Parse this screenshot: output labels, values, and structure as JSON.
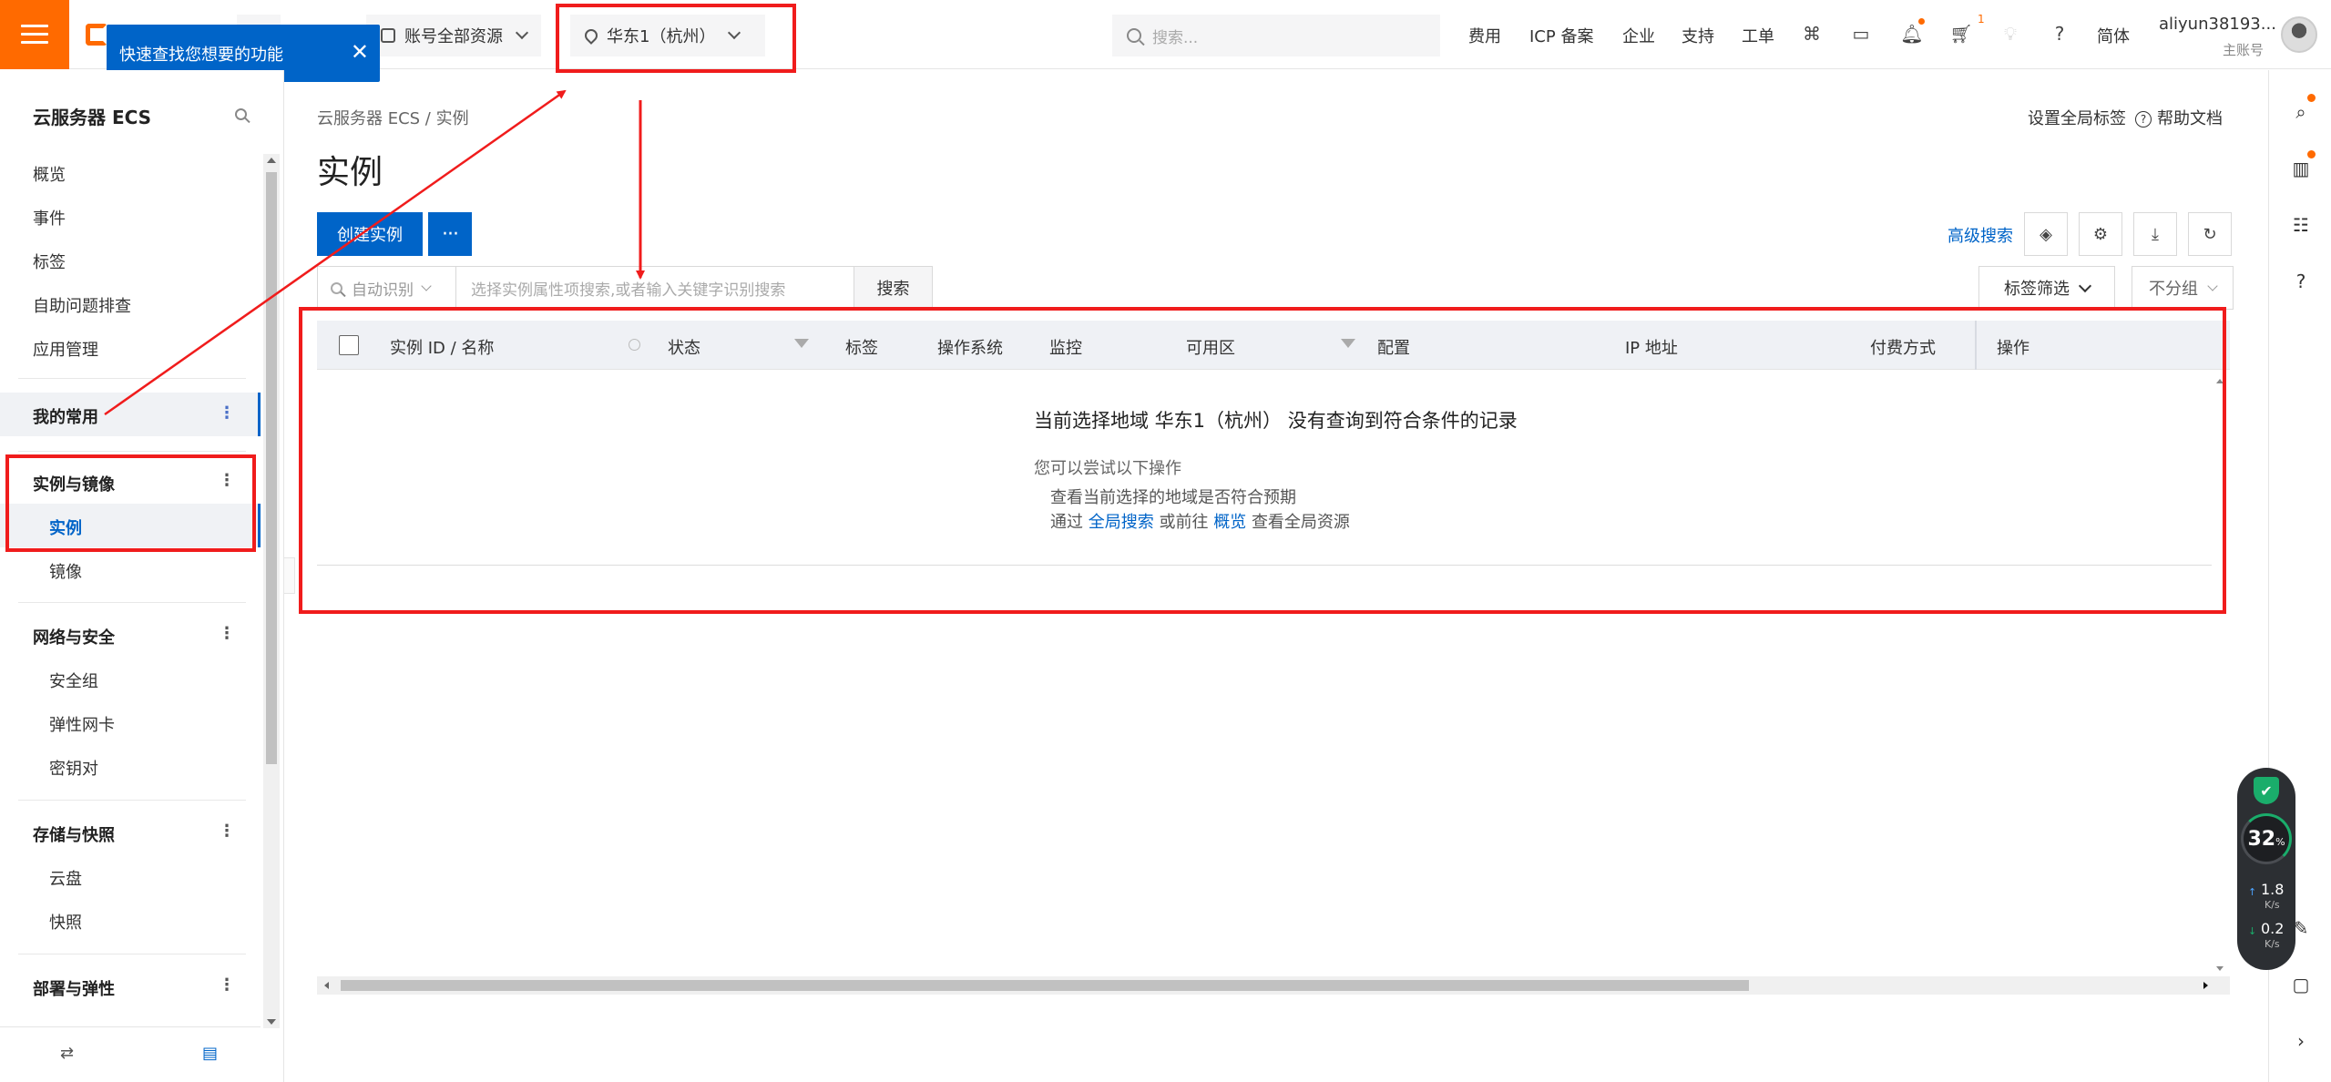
{
  "topbar": {
    "account_scope": "账号全部资源",
    "region": "华东1（杭州）",
    "search_placeholder": "搜索...",
    "links": [
      "费用",
      "ICP 备案",
      "企业",
      "支持",
      "工单"
    ],
    "cart_badge": "1",
    "language": "简体",
    "username": "aliyun38193...",
    "account_type": "主账号"
  },
  "tooltip": {
    "text": "快速查找您想要的功能",
    "close": "✕"
  },
  "sidebar": {
    "title": "云服务器 ECS",
    "items": [
      "概览",
      "事件",
      "标签",
      "自助问题排查",
      "应用管理"
    ],
    "favorites": "我的常用",
    "groups": [
      {
        "label": "实例与镜像",
        "items": [
          "实例",
          "镜像"
        ]
      },
      {
        "label": "网络与安全",
        "items": [
          "安全组",
          "弹性网卡",
          "密钥对"
        ]
      },
      {
        "label": "存储与快照",
        "items": [
          "云盘",
          "快照"
        ]
      },
      {
        "label": "部署与弹性",
        "items": []
      }
    ],
    "more_icon": "⋮"
  },
  "main": {
    "breadcrumb": "云服务器 ECS  /  实例",
    "page_title": "实例",
    "set_tags": "设置全局标签",
    "help_docs": "帮助文档",
    "create_button": "创建实例",
    "more_button": "···",
    "advanced_search": "高级搜索",
    "filter": {
      "mode": "自动识别",
      "placeholder": "选择实例属性项搜索,或者输入关键字识别搜索",
      "search_button": "搜索",
      "tag_filter": "标签筛选",
      "group": "不分组"
    },
    "columns": [
      "实例 ID / 名称",
      "状态",
      "标签",
      "操作系统",
      "监控",
      "可用区",
      "配置",
      "IP 地址",
      "付费方式",
      "操作"
    ],
    "empty": {
      "title": "当前选择地域 华东1（杭州） 没有查询到符合条件的记录",
      "hint": "您可以尝试以下操作",
      "line1": "查看当前选择的地域是否符合预期",
      "line2_prefix": "通过",
      "line2_link1": "全局搜索",
      "line2_mid": "或前往",
      "line2_link2": "概览",
      "line2_suffix": "查看全局资源"
    }
  },
  "speed_widget": {
    "percent": "32",
    "percent_unit": "%",
    "upload": "1.8",
    "download": "0.2",
    "unit": "K/s"
  },
  "colors": {
    "brand_orange": "#ff6a00",
    "primary_blue": "#0064c8",
    "annotation_red": "#f01c1c"
  }
}
